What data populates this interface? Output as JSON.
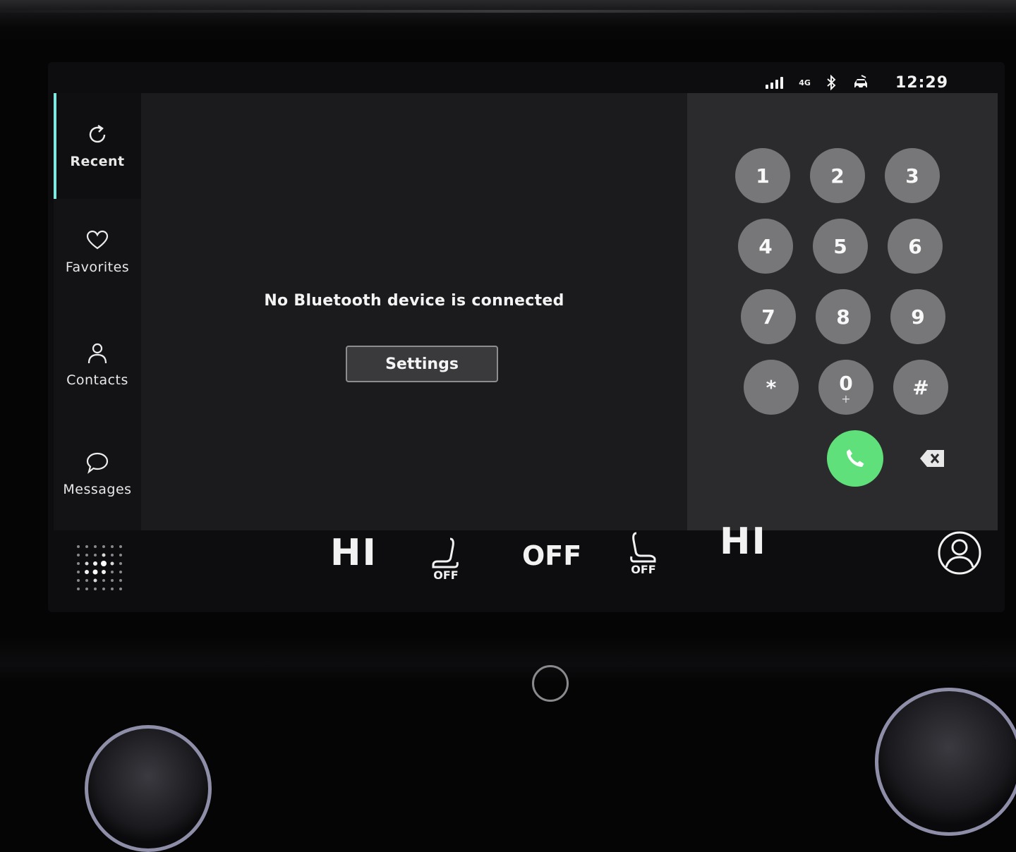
{
  "status": {
    "network": "4G",
    "time": "12:29"
  },
  "nav": {
    "items": [
      {
        "label": "Recent",
        "icon": "refresh-icon",
        "active": true
      },
      {
        "label": "Favorites",
        "icon": "heart-icon",
        "active": false
      },
      {
        "label": "Contacts",
        "icon": "person-icon",
        "active": false
      },
      {
        "label": "Messages",
        "icon": "chat-bubble-icon",
        "active": false
      }
    ]
  },
  "main": {
    "message": "No Bluetooth device is connected",
    "settings_label": "Settings"
  },
  "dialpad": {
    "keys": [
      {
        "label": "1"
      },
      {
        "label": "2"
      },
      {
        "label": "3"
      },
      {
        "label": "4"
      },
      {
        "label": "5"
      },
      {
        "label": "6"
      },
      {
        "label": "7"
      },
      {
        "label": "8"
      },
      {
        "label": "9"
      },
      {
        "label": "*"
      },
      {
        "label": "0",
        "sub": "+"
      },
      {
        "label": "#"
      }
    ],
    "call_icon": "phone-icon",
    "delete_icon": "backspace-icon"
  },
  "climate": {
    "left_temp": "HI",
    "left_seat_label": "OFF",
    "fan": "OFF",
    "right_seat_label": "OFF",
    "right_temp": "HI"
  },
  "colors": {
    "accent": "#7fe8e0",
    "call": "#5fe07a",
    "key": "#77777a"
  }
}
